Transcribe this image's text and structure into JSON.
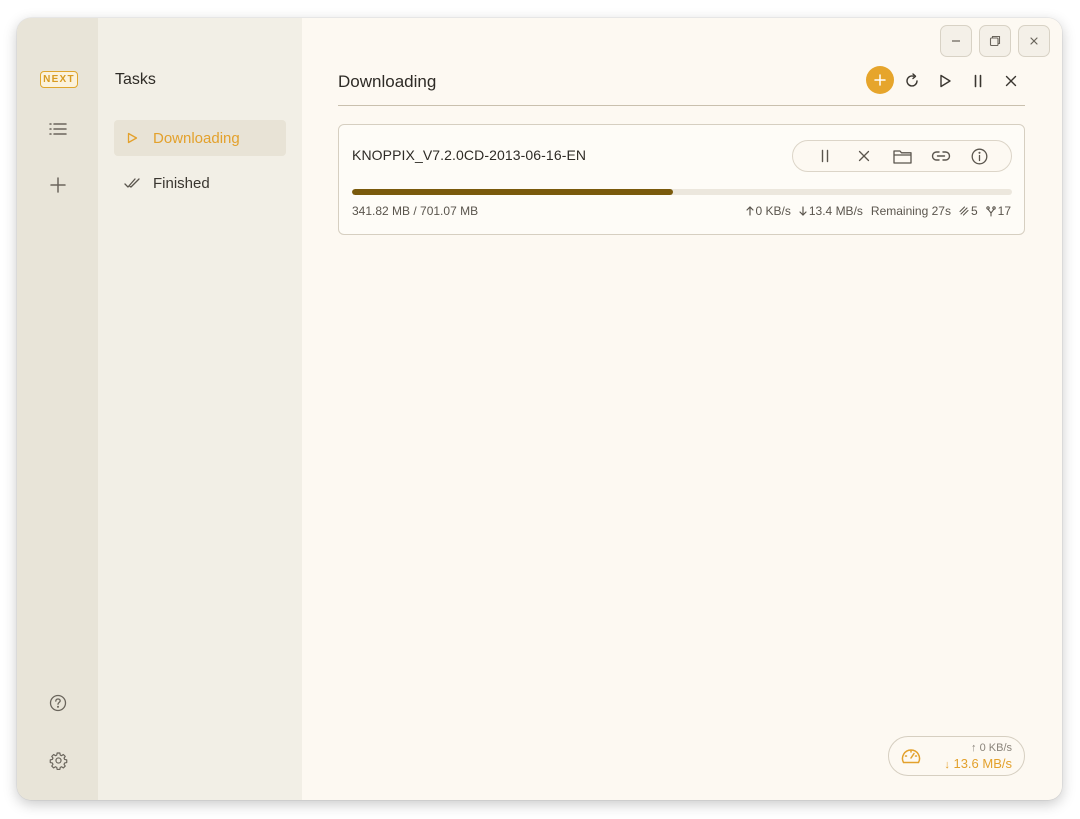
{
  "app": {
    "badge": "NEXT"
  },
  "rail": {
    "items": [
      {
        "icon": "list-icon"
      },
      {
        "icon": "plus-icon"
      },
      {
        "icon": "help-icon"
      },
      {
        "icon": "gear-icon"
      }
    ]
  },
  "subnav": {
    "title": "Tasks",
    "items": [
      {
        "label": "Downloading",
        "icon": "play-outline-icon",
        "active": true
      },
      {
        "label": "Finished",
        "icon": "double-check-icon",
        "active": false
      }
    ]
  },
  "main": {
    "title": "Downloading"
  },
  "tasks": [
    {
      "name": "KNOPPIX_V7.2.0CD-2013-06-16-EN",
      "progress": 0.487,
      "size_text": "341.82 MB / 701.07 MB",
      "upload_speed": "0 KB/s",
      "download_speed": "13.4 MB/s",
      "remaining": "Remaining 27s",
      "connections": "5",
      "peers": "17"
    }
  ],
  "speedometer": {
    "upload": "0 KB/s",
    "download": "13.6 MB/s"
  },
  "colors": {
    "accent": "#e6a52c",
    "progress": "#7a5a0c",
    "rail_bg": "#e8e4d8",
    "subnav_bg": "#f2efe6",
    "main_bg": "#fdf9f2"
  }
}
